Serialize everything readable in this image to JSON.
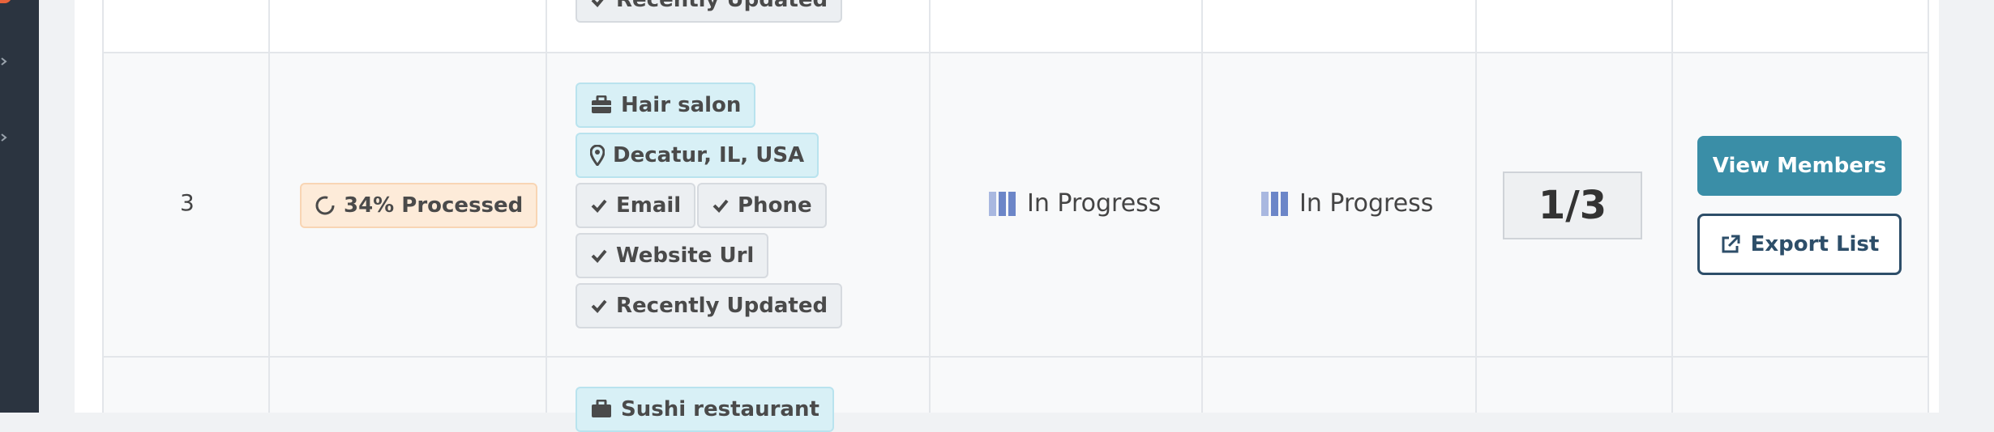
{
  "row": {
    "number": "3",
    "progress_label": "34% Processed",
    "tags": {
      "category": "Hair salon",
      "location": "Decatur, IL, USA",
      "email": "Email",
      "phone": "Phone",
      "website": "Website Url",
      "recent": "Recently Updated"
    },
    "status_one": "In Progress",
    "status_two": "In Progress",
    "counter": "1/3",
    "view_members": "View Members",
    "export_list": "Export List"
  },
  "prev_row": {
    "recent": "Recently Updated"
  },
  "next_row": {
    "category": "Sushi restaurant"
  },
  "colors": {
    "primary_button": "#3a8ea7",
    "outline_button": "#2d4e69",
    "info_badge": "#d8f0f6",
    "warn_badge": "#fdebd9",
    "status_bars": "#6c86c8"
  }
}
